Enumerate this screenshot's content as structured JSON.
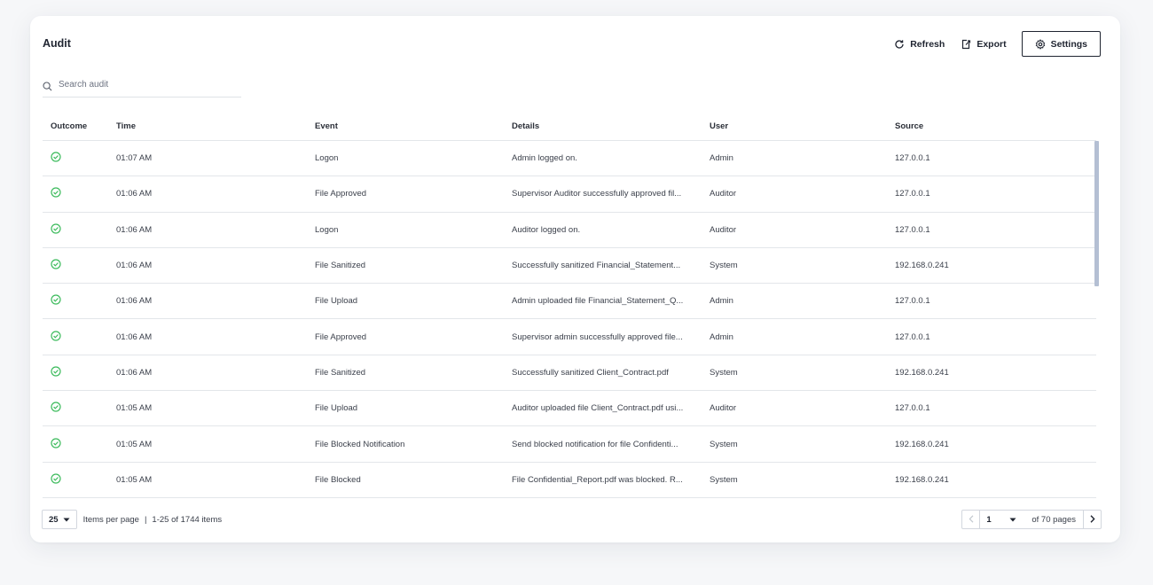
{
  "header": {
    "title": "Audit",
    "refresh_label": "Refresh",
    "export_label": "Export",
    "settings_label": "Settings"
  },
  "search": {
    "placeholder": "Search audit",
    "value": ""
  },
  "columns": [
    "Outcome",
    "Time",
    "Event",
    "Details",
    "User",
    "Source"
  ],
  "rows": [
    {
      "outcome": "success",
      "time": "01:07 AM",
      "event": "Logon",
      "details": "Admin logged on.",
      "user": "Admin",
      "source": "127.0.0.1"
    },
    {
      "outcome": "success",
      "time": "01:06 AM",
      "event": "File Approved",
      "details": "Supervisor Auditor successfully approved fil...",
      "user": "Auditor",
      "source": "127.0.0.1"
    },
    {
      "outcome": "success",
      "time": "01:06 AM",
      "event": "Logon",
      "details": "Auditor logged on.",
      "user": "Auditor",
      "source": "127.0.0.1"
    },
    {
      "outcome": "success",
      "time": "01:06 AM",
      "event": "File Sanitized",
      "details": "Successfully sanitized Financial_Statement...",
      "user": "System",
      "source": "192.168.0.241"
    },
    {
      "outcome": "success",
      "time": "01:06 AM",
      "event": "File Upload",
      "details": "Admin uploaded file Financial_Statement_Q...",
      "user": "Admin",
      "source": "127.0.0.1"
    },
    {
      "outcome": "success",
      "time": "01:06 AM",
      "event": "File Approved",
      "details": "Supervisor admin successfully approved file...",
      "user": "Admin",
      "source": "127.0.0.1"
    },
    {
      "outcome": "success",
      "time": "01:06 AM",
      "event": "File Sanitized",
      "details": "Successfully sanitized Client_Contract.pdf",
      "user": "System",
      "source": "192.168.0.241"
    },
    {
      "outcome": "success",
      "time": "01:05 AM",
      "event": "File Upload",
      "details": "Auditor uploaded file Client_Contract.pdf usi...",
      "user": "Auditor",
      "source": "127.0.0.1"
    },
    {
      "outcome": "success",
      "time": "01:05 AM",
      "event": "File Blocked Notification",
      "details": "Send blocked notification for file Confidenti...",
      "user": "System",
      "source": "192.168.0.241"
    },
    {
      "outcome": "success",
      "time": "01:05 AM",
      "event": "File Blocked",
      "details": "File Confidential_Report.pdf was blocked. R...",
      "user": "System",
      "source": "192.168.0.241"
    }
  ],
  "footer": {
    "per_page": "25",
    "per_page_label": "Items per page",
    "separator": "|",
    "range_label": "1-25 of 1744 items",
    "current_page": "1",
    "pages_label": "of 70 pages"
  },
  "icons": {
    "refresh": "refresh-icon",
    "export": "export-icon",
    "settings": "gear-icon",
    "search": "search-icon",
    "outcome_success": "check-circle-icon"
  },
  "colors": {
    "success": "#3dbb5d",
    "scrollbar": "#b4bfd3",
    "text": "#2b2f38"
  }
}
